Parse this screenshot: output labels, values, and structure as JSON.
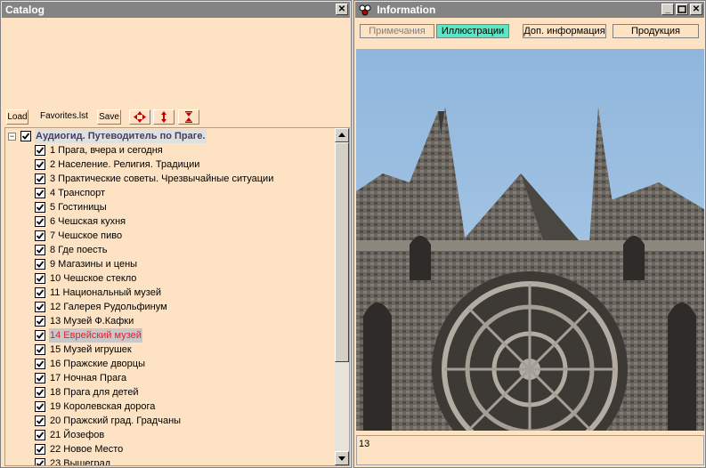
{
  "catalog": {
    "title": "Catalog",
    "toolbar": {
      "load_label": "Load",
      "file_label": "Favorites.lst",
      "save_label": "Save"
    },
    "tree": {
      "root_label": "Аудиогид. Путеводитель по Праге.",
      "items": [
        "1 Прага, вчера и сегодня",
        "2 Население. Религия. Традиции",
        "3 Практические советы. Чрезвычайные ситуации",
        "4 Транспорт",
        "5 Гостиницы",
        "6 Чешская кухня",
        "7 Чешское пиво",
        "8 Где поесть",
        "9 Магазины и цены",
        "10 Чешское стекло",
        "11 Национальный музей",
        "12 Галерея Рудольфинум",
        "13 Музей Ф.Кафки",
        "14 Еврейский музей",
        "15 Музей игрушек",
        "16 Пражские дворцы",
        "17 Ночная Прага",
        "18 Прага для детей",
        "19 Королевская дорога",
        "20 Пражский град. Градчаны",
        "21 Йозефов",
        "22 Новое Место",
        "23 Вышеград"
      ],
      "selected_index": 13
    }
  },
  "info": {
    "title": "Information",
    "tabs": [
      "Примечания",
      "Иллюстрации",
      "Доп. информация",
      "Продукция"
    ],
    "active_tab": 1,
    "status_text": "13"
  },
  "colors": {
    "panel_bg": "#fde3c3",
    "titlebar": "#848484",
    "active_tab": "#5de6c4",
    "selected_text": "#e0202a"
  }
}
